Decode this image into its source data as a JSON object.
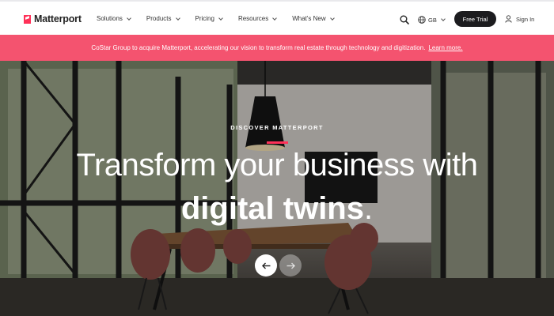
{
  "brand": {
    "name": "Matterport"
  },
  "nav": {
    "items": [
      {
        "label": "Solutions"
      },
      {
        "label": "Products"
      },
      {
        "label": "Pricing"
      },
      {
        "label": "Resources"
      },
      {
        "label": "What's New"
      }
    ],
    "region": "GB",
    "trial_label": "Free Trial",
    "signin_label": "Sign In"
  },
  "banner": {
    "text": "CoStar Group to acquire Matterport, accelerating our vision to transform real estate through technology and digitization.",
    "link": "Learn more.",
    "color": "#f4536f"
  },
  "hero": {
    "eyebrow": "DISCOVER MATTERPORT",
    "headline_line1": "Transform your business with",
    "headline_bold": "digital twins",
    "headline_period": ".",
    "accent": "#ff3158"
  },
  "icons": {
    "search": "search-icon",
    "globe": "globe-icon",
    "user": "user-icon",
    "prev": "arrow-left-icon",
    "next": "arrow-right-icon"
  }
}
